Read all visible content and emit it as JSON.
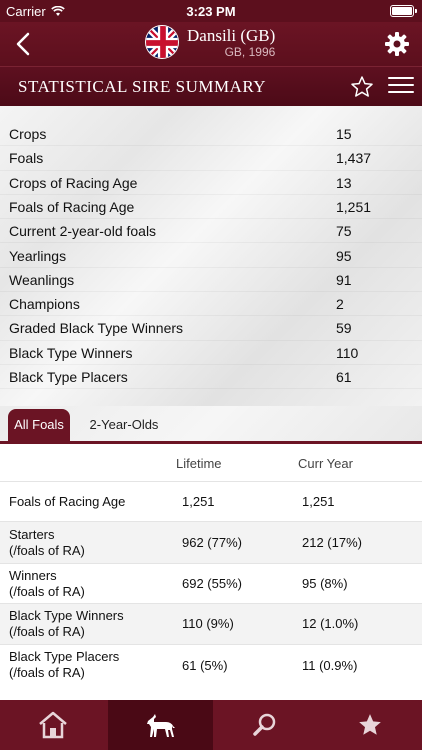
{
  "status_bar": {
    "carrier": "Carrier",
    "time": "3:23 PM"
  },
  "header": {
    "horse_name": "Dansili (GB)",
    "horse_meta": "GB, 1996"
  },
  "section": {
    "title": "STATISTICAL SIRE SUMMARY"
  },
  "summary": [
    {
      "label": "Crops",
      "value": "15"
    },
    {
      "label": "Foals",
      "value": "1,437"
    },
    {
      "label": "Crops of Racing Age",
      "value": "13"
    },
    {
      "label": "Foals of Racing Age",
      "value": "1,251"
    },
    {
      "label": "Current 2-year-old foals",
      "value": "75"
    },
    {
      "label": "Yearlings",
      "value": "95"
    },
    {
      "label": "Weanlings",
      "value": "91"
    },
    {
      "label": "Champions",
      "value": "2"
    },
    {
      "label": "Graded Black Type Winners",
      "value": "59"
    },
    {
      "label": "Black Type Winners",
      "value": "110"
    },
    {
      "label": "Black Type Placers",
      "value": "61"
    }
  ],
  "tabs": [
    {
      "label": "All Foals",
      "active": true
    },
    {
      "label": "2-Year-Olds",
      "active": false
    }
  ],
  "detail": {
    "columns": [
      "Lifetime",
      "Curr Year"
    ],
    "rows": [
      {
        "label": "Foals of Racing Age",
        "lifetime": "1,251",
        "curr_year": "1,251"
      },
      {
        "label": "Starters\n(/foals of RA)",
        "lifetime": "962 (77%)",
        "curr_year": "212 (17%)"
      },
      {
        "label": "Winners\n(/foals of RA)",
        "lifetime": "692 (55%)",
        "curr_year": "95 (8%)"
      },
      {
        "label": "Black Type Winners\n(/foals of RA)",
        "lifetime": "110 (9%)",
        "curr_year": "12 (1.0%)"
      },
      {
        "label": "Black Type Placers\n(/foals of RA)",
        "lifetime": "61 (5%)",
        "curr_year": "11 (0.9%)"
      }
    ]
  },
  "tab_bar": [
    {
      "icon": "home-icon",
      "selected": false
    },
    {
      "icon": "horse-icon",
      "selected": true
    },
    {
      "icon": "search-icon",
      "selected": false
    },
    {
      "icon": "star-icon",
      "selected": false
    }
  ],
  "colors": {
    "brand": "#6b1424",
    "brand_dark": "#4a0915"
  }
}
